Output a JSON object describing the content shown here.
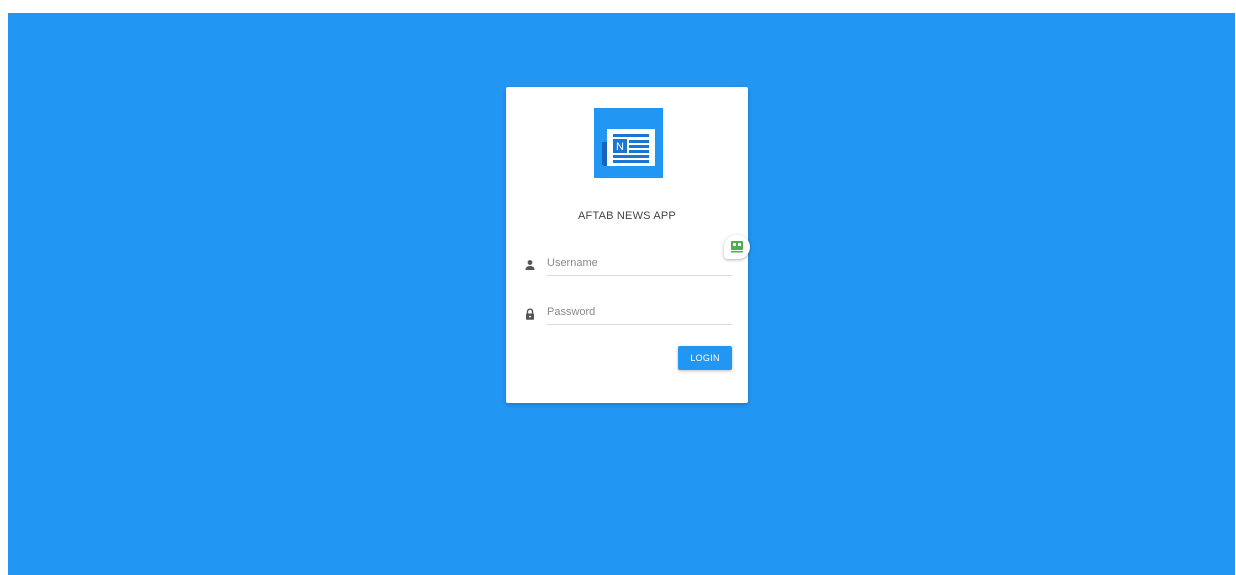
{
  "app": {
    "title": "AFTAB NEWS APP",
    "logo_icon": "newspaper-icon",
    "logo_letter": "N"
  },
  "form": {
    "username": {
      "placeholder": "Username",
      "value": "",
      "icon": "person-icon"
    },
    "password": {
      "placeholder": "Password",
      "value": "",
      "icon": "lock-icon"
    },
    "login_label": "LOGIN"
  },
  "extension_badge": {
    "icon": "password-manager-icon"
  },
  "colors": {
    "background": "#2196f3",
    "accent": "#2196f3",
    "card": "#ffffff",
    "badge_green": "#4caf50"
  }
}
